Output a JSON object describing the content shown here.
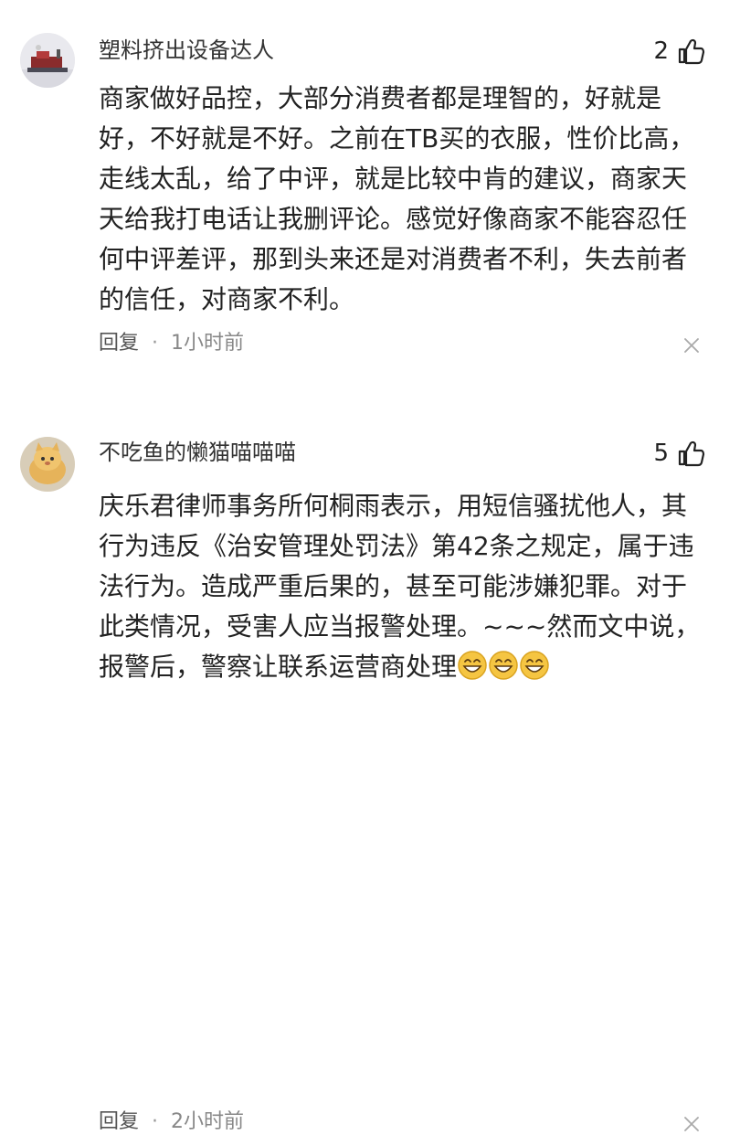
{
  "comments": [
    {
      "username": "塑料挤出设备达人",
      "likes": "2",
      "text": "商家做好品控，大部分消费者都是理智的，好就是\n好，不好就是不好。之前在TB买的衣服，性价比高，\n走线太乱，给了中评，就是比较中肯的建议，商家天\n天给我打电话让我删评论。感觉好像商家不能容忍任\n何中评差评，那到头来还是对消费者不利，失去前者\n的信任，对商家不利。",
      "reply_label": "回复",
      "separator": "·",
      "time": "1小时前",
      "avatar_icon": "factory-avatar-icon"
    },
    {
      "username": "不吃鱼的懒猫喵喵喵",
      "likes": "5",
      "text": "庆乐君律师事务所何桐雨表示，用短信骚扰他人，其\n行为违反《治安管理处罚法》第42条之规定，属于违\n法行为。造成严重后果的，甚至可能涉嫌犯罪。对于\n此类情况，受害人应当报警处理。~~~然而文中说，\n报警后，警察让联系运营商处理",
      "emojis": [
        "grinning-emoji",
        "grinning-emoji",
        "grinning-emoji"
      ],
      "reply_label": "回复",
      "separator": "·",
      "time": "2小时前",
      "avatar_icon": "cat-avatar-icon"
    }
  ],
  "colors": {
    "text": "#222222",
    "meta": "#888888",
    "emoji": "#f5c542"
  }
}
